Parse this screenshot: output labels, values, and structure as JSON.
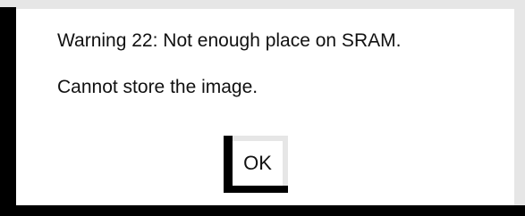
{
  "dialog": {
    "message_line1": "Warning 22: Not enough place on SRAM.",
    "message_line2": "Cannot store the image.",
    "ok_label": "OK"
  },
  "colors": {
    "background": "#ffffff",
    "bevel_light": "#e6e6e6",
    "bevel_dark": "#000000",
    "text": "#111111"
  }
}
